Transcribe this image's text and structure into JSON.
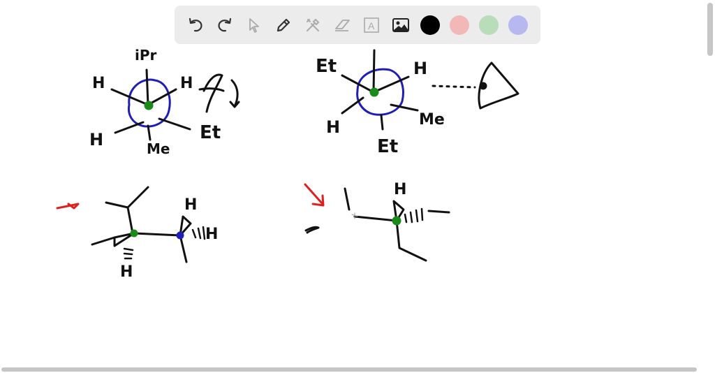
{
  "toolbar": {
    "tools": [
      {
        "name": "undo-icon"
      },
      {
        "name": "redo-icon"
      },
      {
        "name": "pointer-icon"
      },
      {
        "name": "pen-icon"
      },
      {
        "name": "tools-icon"
      },
      {
        "name": "eraser-icon"
      },
      {
        "name": "text-icon",
        "glyph": "A"
      },
      {
        "name": "image-icon"
      }
    ],
    "colors": [
      "#000000",
      "#f2b8b8",
      "#b9dcb9",
      "#b8b8f0"
    ],
    "selected_color": "#000000"
  },
  "canvas": {
    "labels": {
      "n1_top": "iPr",
      "n1_h_left": "H",
      "n1_h_right": "H",
      "n1_h_bottom_left": "H",
      "n1_bottom": "Me",
      "n1_right": "Et",
      "n2_left": "Et",
      "n2_right": "H",
      "n2_h_bottom": "H",
      "n2_me": "Me",
      "n2_bottom": "Et",
      "z1_h_top": "H",
      "z1_h_right": "H",
      "z1_h_bottom": "H",
      "z2_h_top": "H"
    },
    "ink_colors": {
      "black": "#111111",
      "blue": "#1f1fb8",
      "green": "#1a8a1a",
      "red": "#e0201f"
    }
  }
}
